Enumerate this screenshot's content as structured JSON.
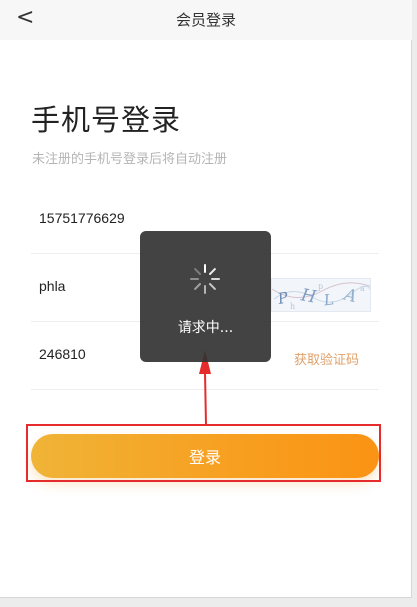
{
  "nav": {
    "back_glyph": "<",
    "title": "会员登录",
    "back_icon": "chevron-left-icon"
  },
  "header": {
    "title": "手机号登录",
    "subtitle": "未注册的手机号登录后将自动注册"
  },
  "form": {
    "phone_value": "15751776629",
    "captcha_value": "phla",
    "captcha_image_text": "PHLA",
    "sms_code_value": "246810",
    "get_code_label": "获取验证码"
  },
  "login_button": {
    "label": "登录"
  },
  "loading_toast": {
    "text": "请求中...",
    "icon": "spinner-icon"
  },
  "annotation": {
    "highlight_color": "#e52b2b",
    "arrow_icon": "red-arrow-icon"
  },
  "colors": {
    "accent_start": "#f0b437",
    "accent_end": "#fb9314",
    "get_code_text": "#e0a06a"
  }
}
